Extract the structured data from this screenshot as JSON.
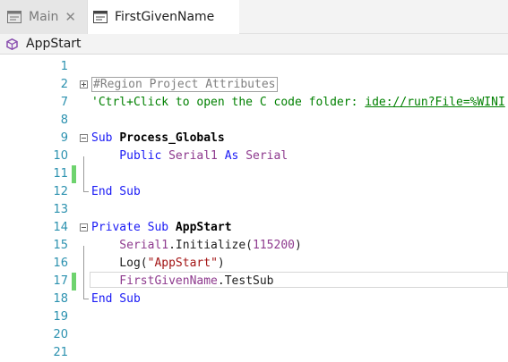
{
  "tabs": [
    {
      "label": "Main",
      "icon": "module-icon",
      "active": false,
      "closable": true
    },
    {
      "label": "FirstGivenName",
      "icon": "module-icon",
      "active": true,
      "closable": false
    }
  ],
  "breadcrumb": {
    "label": "AppStart",
    "icon": "cube-icon",
    "icon_color": "#8a4fb0"
  },
  "editor": {
    "line_number_color": "#2b91af",
    "modified_marker_color": "#6ed36e",
    "lines": [
      {
        "num": "1",
        "tokens": []
      },
      {
        "num": "2",
        "tokens": [
          {
            "t": "#Region Project Attributes",
            "c": "region"
          }
        ]
      },
      {
        "num": "7",
        "tokens": [
          {
            "t": "'Ctrl+Click to open the C code folder: ",
            "c": "cm"
          },
          {
            "t": "ide://run?File=%WINI",
            "c": "link"
          }
        ]
      },
      {
        "num": "8",
        "tokens": []
      },
      {
        "num": "9",
        "tokens": [
          {
            "t": "Sub ",
            "c": "kw"
          },
          {
            "t": "Process_Globals",
            "c": "bold"
          }
        ]
      },
      {
        "num": "10",
        "tokens": [
          {
            "t": "    Public ",
            "c": "kw"
          },
          {
            "t": "Serial1",
            "c": "cls"
          },
          {
            "t": " As ",
            "c": "kw"
          },
          {
            "t": "Serial",
            "c": "cls"
          }
        ]
      },
      {
        "num": "11",
        "tokens": []
      },
      {
        "num": "12",
        "tokens": [
          {
            "t": "End Sub",
            "c": "kw"
          }
        ]
      },
      {
        "num": "13",
        "tokens": []
      },
      {
        "num": "14",
        "tokens": [
          {
            "t": "Private Sub ",
            "c": "kw"
          },
          {
            "t": "AppStart",
            "c": "bold"
          }
        ]
      },
      {
        "num": "15",
        "tokens": [
          {
            "t": "    Serial1",
            "c": "cls"
          },
          {
            "t": ".Initialize(",
            "c": ""
          },
          {
            "t": "115200",
            "c": "num"
          },
          {
            "t": ")",
            "c": ""
          }
        ]
      },
      {
        "num": "16",
        "tokens": [
          {
            "t": "    Log(",
            "c": ""
          },
          {
            "t": "\"AppStart\"",
            "c": "str"
          },
          {
            "t": ")",
            "c": ""
          }
        ]
      },
      {
        "num": "17",
        "tokens": [
          {
            "t": "    FirstGivenName",
            "c": "cls"
          },
          {
            "t": ".TestSub",
            "c": ""
          }
        ]
      },
      {
        "num": "18",
        "tokens": [
          {
            "t": "End Sub",
            "c": "kw"
          }
        ]
      },
      {
        "num": "19",
        "tokens": []
      },
      {
        "num": "20",
        "tokens": []
      },
      {
        "num": "21",
        "tokens": []
      }
    ]
  }
}
